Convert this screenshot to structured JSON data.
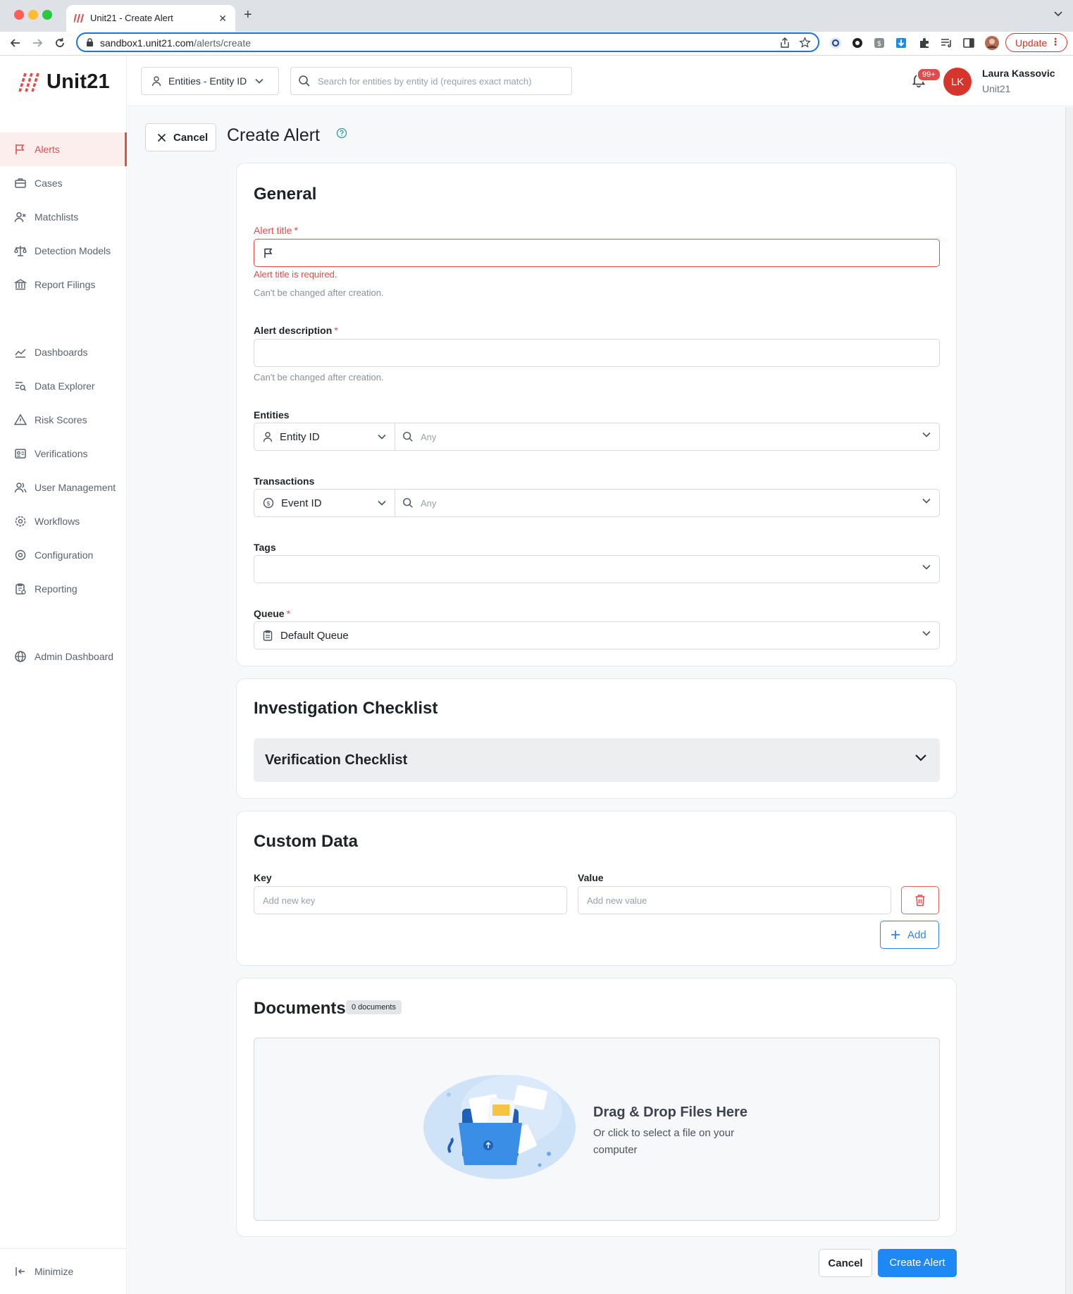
{
  "browser": {
    "tab_title": "Unit21 - Create Alert",
    "url_host": "sandbox1.unit21.com",
    "url_path": "/alerts/create",
    "update_label": "Update"
  },
  "app": {
    "logo_text": "Unit21",
    "accent_color": "#e04e4e",
    "primary_color": "#1e88f5"
  },
  "sidebar": {
    "items": [
      {
        "label": "Alerts",
        "icon": "flag-icon",
        "active": true
      },
      {
        "label": "Cases",
        "icon": "briefcase-icon"
      },
      {
        "label": "Matchlists",
        "icon": "user-x-icon"
      },
      {
        "label": "Detection Models",
        "icon": "scale-icon"
      },
      {
        "label": "Report Filings",
        "icon": "bank-icon"
      },
      {
        "label": "Dashboards",
        "icon": "chart-line-icon"
      },
      {
        "label": "Data Explorer",
        "icon": "list-search-icon"
      },
      {
        "label": "Risk Scores",
        "icon": "warning-triangle-icon"
      },
      {
        "label": "Verifications",
        "icon": "id-card-icon"
      },
      {
        "label": "User Management",
        "icon": "users-icon"
      },
      {
        "label": "Workflows",
        "icon": "cog-flow-icon"
      },
      {
        "label": "Configuration",
        "icon": "settings-icon"
      },
      {
        "label": "Reporting",
        "icon": "clipboard-report-icon"
      },
      {
        "label": "Admin Dashboard",
        "icon": "globe-icon"
      }
    ],
    "minimize_label": "Minimize"
  },
  "header": {
    "entity_select_label": "Entities - Entity ID",
    "search_placeholder": "Search for entities by entity id (requires exact match)",
    "notification_count": "99+",
    "user_initials": "LK",
    "user_name": "Laura Kassovic",
    "user_org": "Unit21"
  },
  "page": {
    "cancel_label": "Cancel",
    "title": "Create Alert"
  },
  "general": {
    "title": "General",
    "alert_title_label": "Alert title",
    "alert_title_error": "Alert title is required.",
    "alert_title_helper": "Can't be changed after creation.",
    "alert_description_label": "Alert description",
    "alert_description_helper": "Can't be changed after creation.",
    "required_mark": "*",
    "entities_label": "Entities",
    "entities_type": "Entity ID",
    "entities_placeholder": "Any",
    "transactions_label": "Transactions",
    "transactions_type": "Event ID",
    "transactions_placeholder": "Any",
    "tags_label": "Tags",
    "queue_label": "Queue",
    "queue_value": "Default Queue"
  },
  "checklist": {
    "title": "Investigation Checklist",
    "item_label": "Verification Checklist"
  },
  "custom_data": {
    "title": "Custom Data",
    "key_label": "Key",
    "value_label": "Value",
    "key_placeholder": "Add new key",
    "value_placeholder": "Add new value",
    "add_label": "Add"
  },
  "documents": {
    "title": "Documents",
    "count_badge": "0 documents",
    "drop_title": "Drag & Drop Files Here",
    "drop_subtitle": "Or click to select a file on your computer"
  },
  "footer": {
    "cancel_label": "Cancel",
    "create_label": "Create Alert"
  }
}
